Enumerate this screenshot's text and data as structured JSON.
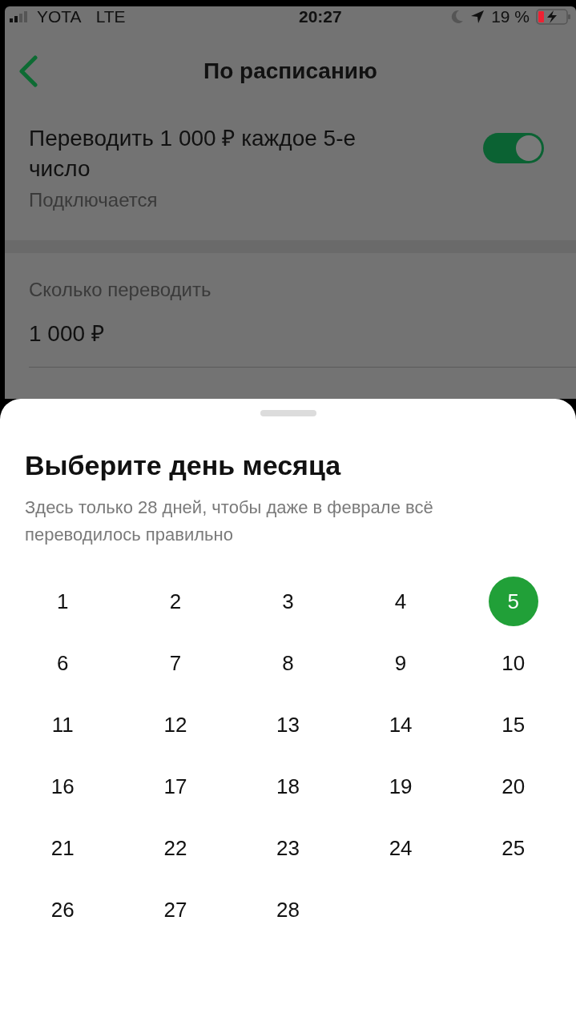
{
  "status_bar": {
    "carrier": "YOTA",
    "network": "LTE",
    "time": "20:27",
    "battery": "19 %"
  },
  "header": {
    "title": "По расписанию"
  },
  "schedule": {
    "title": "Переводить 1 000 ₽ каждое 5-е число",
    "status": "Подключается",
    "on": true
  },
  "amount": {
    "label": "Сколько переводить",
    "value": "1 000 ₽"
  },
  "sheet": {
    "title": "Выберите день месяца",
    "subtitle": "Здесь только 28 дней, чтобы даже в феврале всё переводилось правильно",
    "days": [
      {
        "label": "1",
        "selected": false
      },
      {
        "label": "2",
        "selected": false
      },
      {
        "label": "3",
        "selected": false
      },
      {
        "label": "4",
        "selected": false
      },
      {
        "label": "5",
        "selected": true
      },
      {
        "label": "6",
        "selected": false
      },
      {
        "label": "7",
        "selected": false
      },
      {
        "label": "8",
        "selected": false
      },
      {
        "label": "9",
        "selected": false
      },
      {
        "label": "10",
        "selected": false
      },
      {
        "label": "11",
        "selected": false
      },
      {
        "label": "12",
        "selected": false
      },
      {
        "label": "13",
        "selected": false
      },
      {
        "label": "14",
        "selected": false
      },
      {
        "label": "15",
        "selected": false
      },
      {
        "label": "16",
        "selected": false
      },
      {
        "label": "17",
        "selected": false
      },
      {
        "label": "18",
        "selected": false
      },
      {
        "label": "19",
        "selected": false
      },
      {
        "label": "20",
        "selected": false
      },
      {
        "label": "21",
        "selected": false
      },
      {
        "label": "22",
        "selected": false
      },
      {
        "label": "23",
        "selected": false
      },
      {
        "label": "24",
        "selected": false
      },
      {
        "label": "25",
        "selected": false
      },
      {
        "label": "26",
        "selected": false
      },
      {
        "label": "27",
        "selected": false
      },
      {
        "label": "28",
        "selected": false
      }
    ]
  }
}
